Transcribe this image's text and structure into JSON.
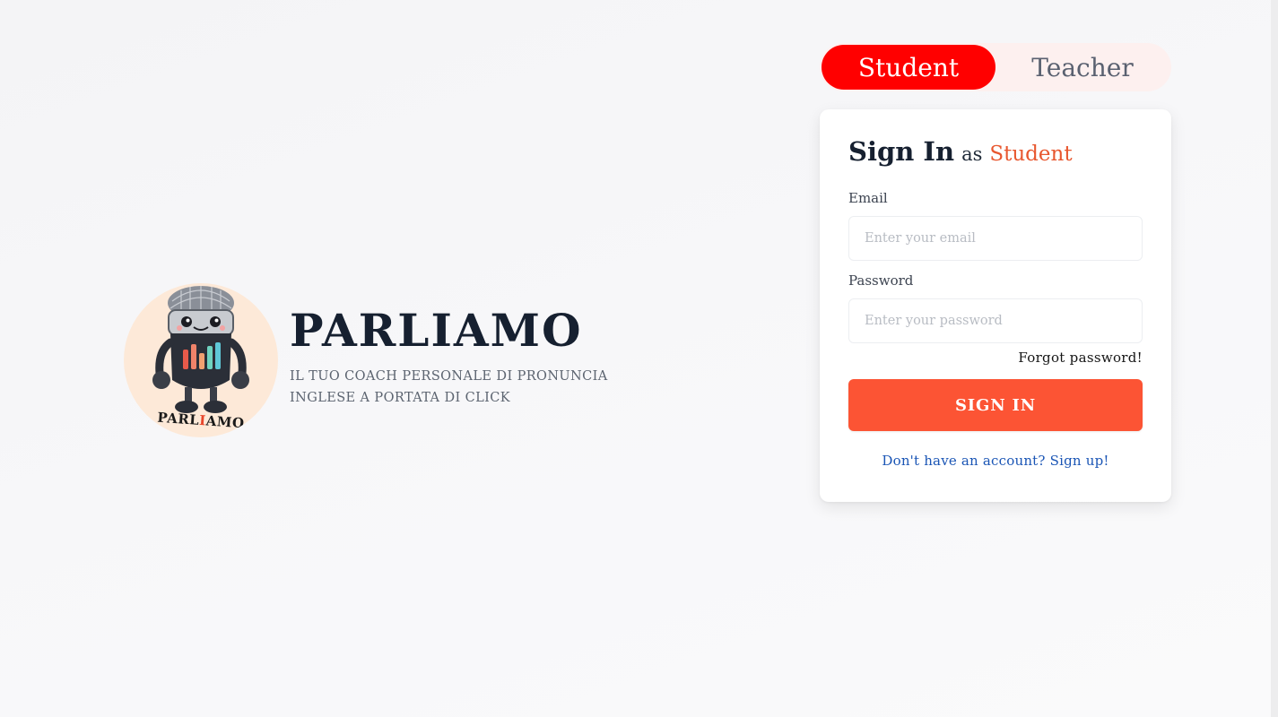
{
  "brand": {
    "title": "PARLIAMO",
    "tagline": "IL TUO COACH PERSONALE DI PRONUNCIA INGLESE A PORTATA DI CLICK",
    "logo_text_start": "PARL",
    "logo_text_accent": "I",
    "logo_text_end": "AMO"
  },
  "role_toggle": {
    "options": [
      {
        "label": "Student",
        "active": true
      },
      {
        "label": "Teacher",
        "active": false
      }
    ]
  },
  "sign_in": {
    "heading_strong": "Sign In",
    "heading_as": "as",
    "heading_role": "Student",
    "email_label": "Email",
    "email_placeholder": "Enter your email",
    "email_value": "",
    "password_label": "Password",
    "password_placeholder": "Enter your password",
    "password_value": "",
    "forgot_label": "Forgot password!",
    "submit_label": "SIGN IN",
    "signup_label": "Don't have an account? Sign up!"
  },
  "colors": {
    "accent": "#fc5434",
    "toggle_active": "#ff0000",
    "role_text": "#e8572f",
    "link": "#1a55b5",
    "logo_bg": "#fde9d8"
  },
  "icons": {
    "logo": "microphone-robot-mascot-icon"
  }
}
